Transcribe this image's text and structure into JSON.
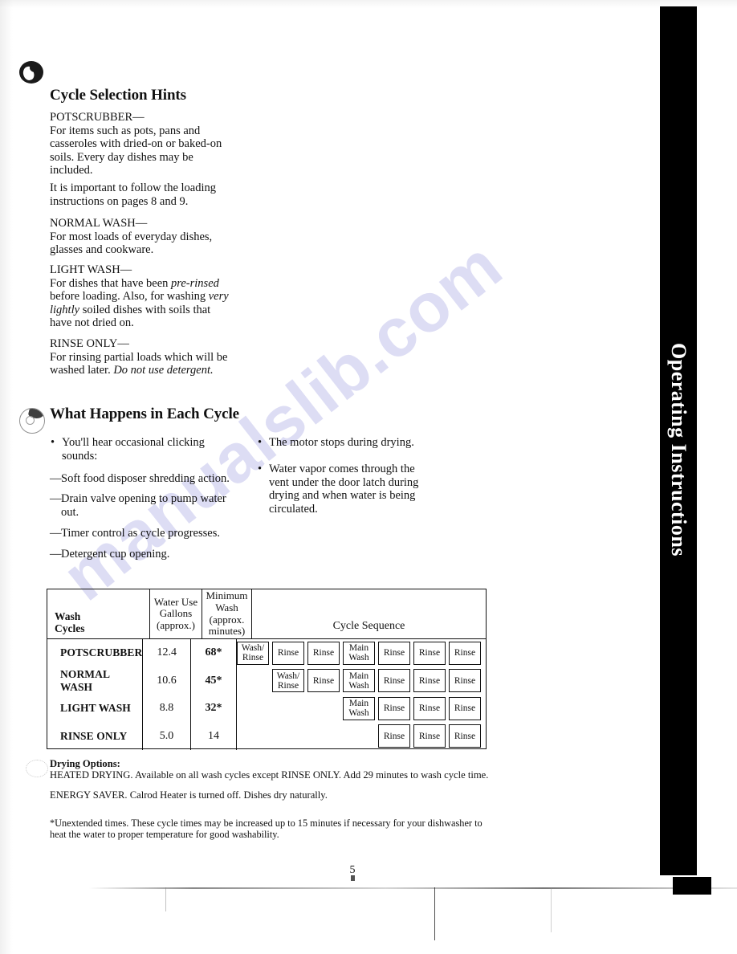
{
  "document": {
    "page_number": "5",
    "side_tab_label": "Operating Instructions",
    "watermark": "manualslib.com"
  },
  "sections": {
    "cycle_hints": {
      "heading": "Cycle Selection Hints",
      "entries": [
        {
          "term": "POTSCRUBBER—",
          "body": "For items such as pots, pans and casseroles with dried-on or baked-on soils. Every day dishes may be included."
        },
        {
          "term": "",
          "body": "It is important to follow the loading instructions on pages 8 and 9."
        },
        {
          "term": "NORMAL WASH—",
          "body": "For most loads of everyday dishes, glasses and cookware."
        },
        {
          "term": "LIGHT WASH—",
          "body_parts": [
            {
              "text": "For dishes that have been ",
              "italic": false
            },
            {
              "text": "pre-rinsed",
              "italic": true
            },
            {
              "text": " before loading. Also, for washing ",
              "italic": false
            },
            {
              "text": "very lightly",
              "italic": true
            },
            {
              "text": " soiled dishes with soils that have not dried on.",
              "italic": false
            }
          ]
        },
        {
          "term": "RINSE ONLY—",
          "body_parts": [
            {
              "text": "For rinsing partial loads which will be washed later. ",
              "italic": false
            },
            {
              "text": "Do not use detergent.",
              "italic": true
            }
          ]
        }
      ]
    },
    "each_cycle": {
      "heading": "What Happens in Each Cycle",
      "left_column": {
        "bullet": "You'll hear occasional clicking sounds:",
        "dashes": [
          "Soft food disposer shredding action.",
          "Drain valve opening to pump water out.",
          "Timer control as cycle progresses.",
          "Detergent cup opening."
        ]
      },
      "right_column": {
        "bullets": [
          "The motor stops during drying.",
          "Water vapor comes through the vent under the door latch during drying and when water is being circulated."
        ]
      }
    }
  },
  "cycle_table": {
    "headers": {
      "wash_cycles": "Wash\nCycles",
      "wash_cycles_line1": "Wash",
      "wash_cycles_line2": "Cycles",
      "water_use": "Water Use\nGallons\n(approx.)",
      "water_use_line1": "Water Use",
      "water_use_line2": "Gallons",
      "water_use_line3": "(approx.)",
      "minimum_wash": "Minimum\nWash\n(approx.\nminutes)",
      "minimum_wash_line1": "Minimum",
      "minimum_wash_line2": "Wash",
      "minimum_wash_line3": "(approx.",
      "minimum_wash_line4": "minutes)",
      "cycle_sequence": "Cycle Sequence"
    },
    "rows": [
      {
        "cycle": "POTSCRUBBER",
        "water_gallons": "12.4",
        "minimum_minutes": "68*",
        "leading_blanks": 0,
        "sequence": [
          "Wash/\nRinse",
          "Rinse",
          "Rinse",
          "Main\nWash",
          "Rinse",
          "Rinse",
          "Rinse"
        ]
      },
      {
        "cycle": "NORMAL WASH",
        "water_gallons": "10.6",
        "minimum_minutes": "45*",
        "leading_blanks": 1,
        "sequence": [
          "Wash/\nRinse",
          "Rinse",
          "Main\nWash",
          "Rinse",
          "Rinse",
          "Rinse"
        ]
      },
      {
        "cycle": "LIGHT WASH",
        "water_gallons": "8.8",
        "minimum_minutes": "32*",
        "leading_blanks": 3,
        "sequence": [
          "Main\nWash",
          "Rinse",
          "Rinse",
          "Rinse"
        ]
      },
      {
        "cycle": "RINSE ONLY",
        "water_gallons": "5.0",
        "minimum_minutes": "14",
        "leading_blanks": 4,
        "sequence": [
          "Rinse",
          "Rinse",
          "Rinse"
        ]
      }
    ]
  },
  "footnotes": {
    "drying_heading": "Drying Options:",
    "heated_drying": "HEATED DRYING. Available on all wash cycles except RINSE ONLY. Add 29 minutes to wash cycle time.",
    "energy_saver": "ENERGY SAVER. Calrod Heater is turned off. Dishes dry naturally.",
    "asterisk": "*Unextended times. These cycle times may be increased up to 15 minutes if necessary for your dishwasher to heat the water to proper temperature for good washability."
  }
}
